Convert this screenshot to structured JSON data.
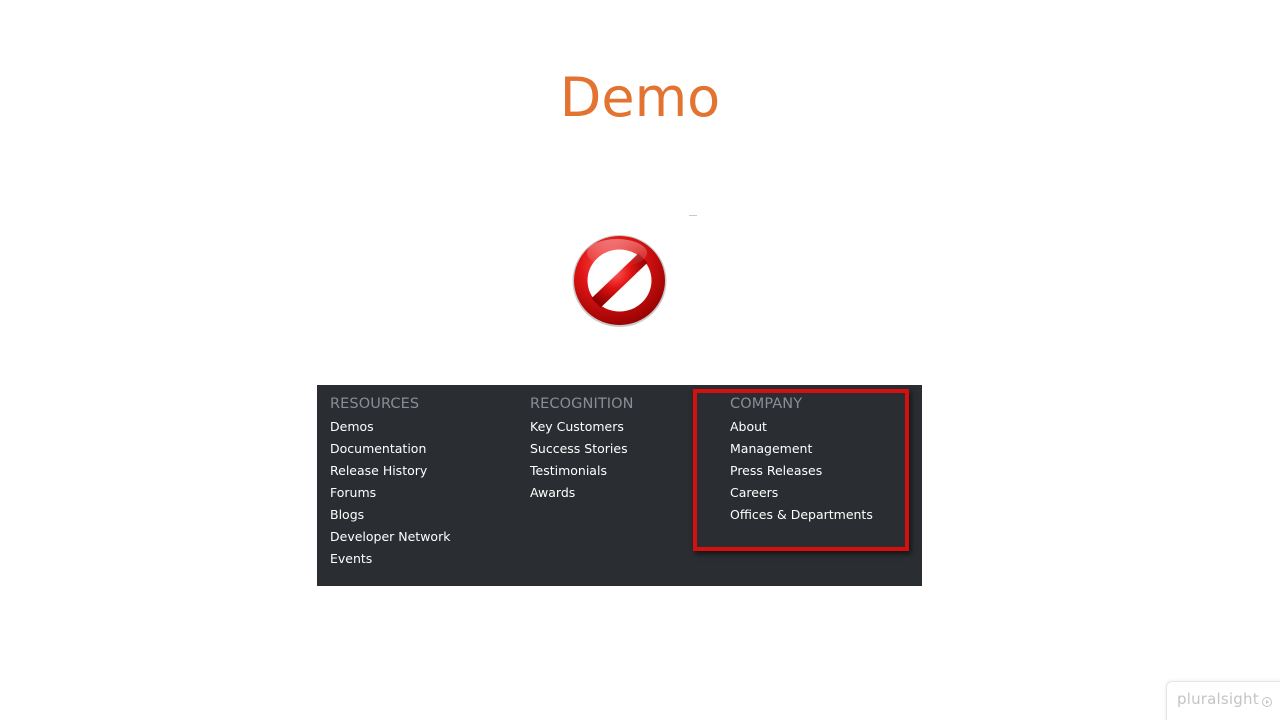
{
  "slide": {
    "title": "Demo"
  },
  "icons": {
    "prohibition": "no-entry-icon",
    "brand_play": "play-circle-icon"
  },
  "footer": {
    "columns": [
      {
        "heading": "RESOURCES",
        "items": [
          "Demos",
          "Documentation",
          "Release History",
          "Forums",
          "Blogs",
          "Developer Network",
          "Events"
        ]
      },
      {
        "heading": "RECOGNITION",
        "items": [
          "Key Customers",
          "Success Stories",
          "Testimonials",
          "Awards"
        ]
      },
      {
        "heading": "COMPANY",
        "items": [
          "About",
          "Management",
          "Press Releases",
          "Careers",
          "Offices & Departments"
        ]
      }
    ]
  },
  "brand": {
    "name": "pluralsight"
  },
  "colors": {
    "title": "#e37330",
    "footer_bg": "#2a2d31",
    "heading": "#8a8e94",
    "highlight": "#d60f0f"
  }
}
